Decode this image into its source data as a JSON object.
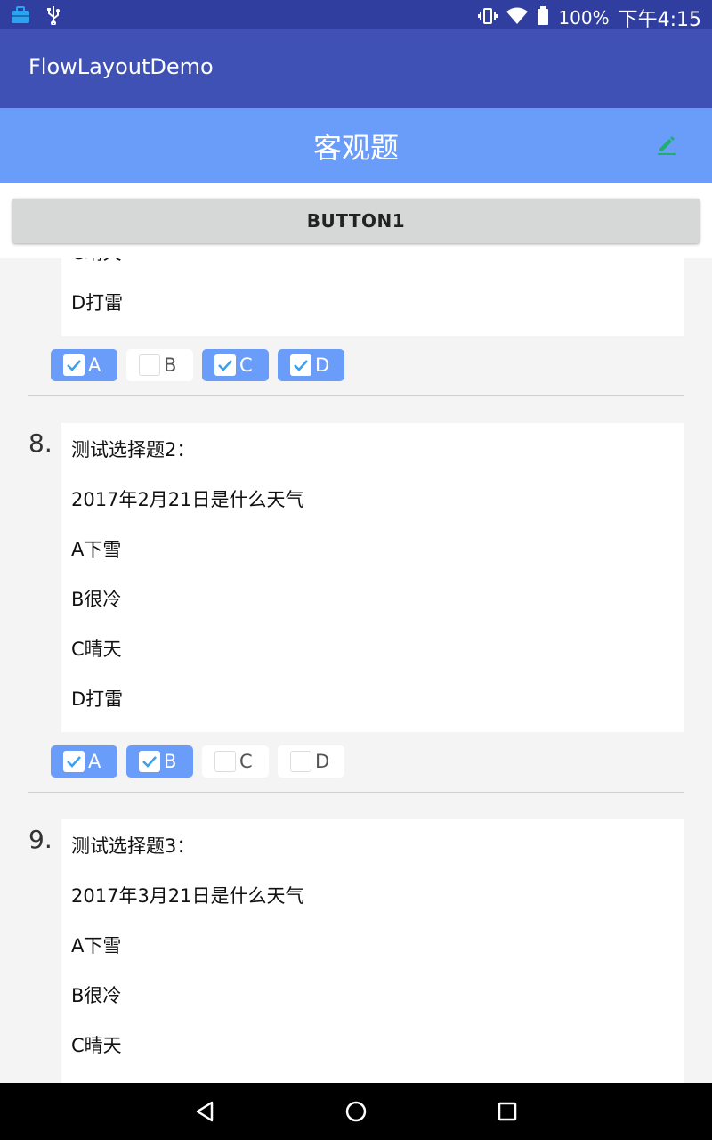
{
  "status_bar": {
    "battery": "100%",
    "time": "下午4:15"
  },
  "app_bar": {
    "title": "FlowLayoutDemo"
  },
  "header": {
    "title": "客观题"
  },
  "button1": {
    "label": "BUTTON1"
  },
  "colors": {
    "primary": "#3f51b5",
    "primary_dark": "#303f9f",
    "accent_blue": "#6a9cf9",
    "edit_green": "#1fae6e"
  },
  "questions": [
    {
      "lines": [
        "C晴天",
        "D打雷"
      ],
      "options": [
        {
          "label": "A",
          "checked": true
        },
        {
          "label": "B",
          "checked": false
        },
        {
          "label": "C",
          "checked": true
        },
        {
          "label": "D",
          "checked": true
        }
      ]
    },
    {
      "number": "8.",
      "lines": [
        "测试选择题2：",
        "2017年2月21日是什么天气",
        "A下雪",
        "B很冷",
        "C晴天",
        "D打雷"
      ],
      "options": [
        {
          "label": "A",
          "checked": true
        },
        {
          "label": "B",
          "checked": true
        },
        {
          "label": "C",
          "checked": false
        },
        {
          "label": "D",
          "checked": false
        }
      ]
    },
    {
      "number": "9.",
      "lines": [
        "测试选择题3：",
        "2017年3月21日是什么天气",
        "A下雪",
        "B很冷",
        "C晴天"
      ]
    }
  ],
  "nav": {
    "icons": [
      "back-icon",
      "home-icon",
      "recents-icon"
    ]
  }
}
